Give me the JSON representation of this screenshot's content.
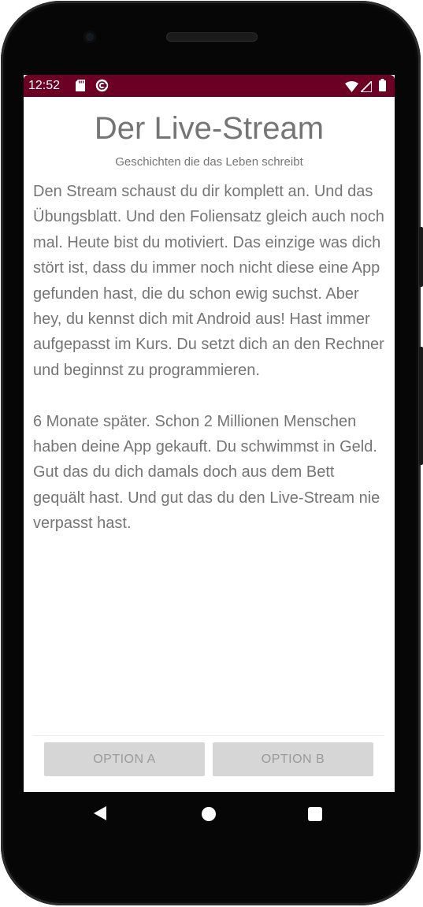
{
  "status_bar": {
    "time": "12:52",
    "left_icons": [
      "sd-card-icon",
      "sync-icon"
    ],
    "right_icons": [
      "wifi-icon",
      "signal-icon",
      "battery-icon"
    ],
    "color": "#6b0024"
  },
  "app": {
    "title": "Der Live-Stream",
    "subtitle": "Geschichten die das Leben schreibt",
    "story": "Den Stream schaust du dir komplett an. Und das Übungsblatt. Und den Foliensatz gleich auch noch mal. Heute bist du motiviert. Das einzige was dich stört ist, dass du immer noch nicht diese eine App gefunden hast, die du schon ewig suchst. Aber hey, du kennst dich mit Android aus! Hast immer aufgepasst im Kurs. Du setzt dich an den Rechner und beginnst zu programmieren.\n\n 6 Monate später. Schon 2 Millionen Menschen haben deine App gekauft. Du schwimmst in Geld. Gut das du dich damals doch aus dem Bett gequält hast. Und gut das du den Live-Stream nie verpasst hast.",
    "option_a": "OPTION A",
    "option_b": "OPTION B"
  },
  "nav_bar": {
    "icons": [
      "back-icon",
      "home-icon",
      "recents-icon"
    ]
  }
}
